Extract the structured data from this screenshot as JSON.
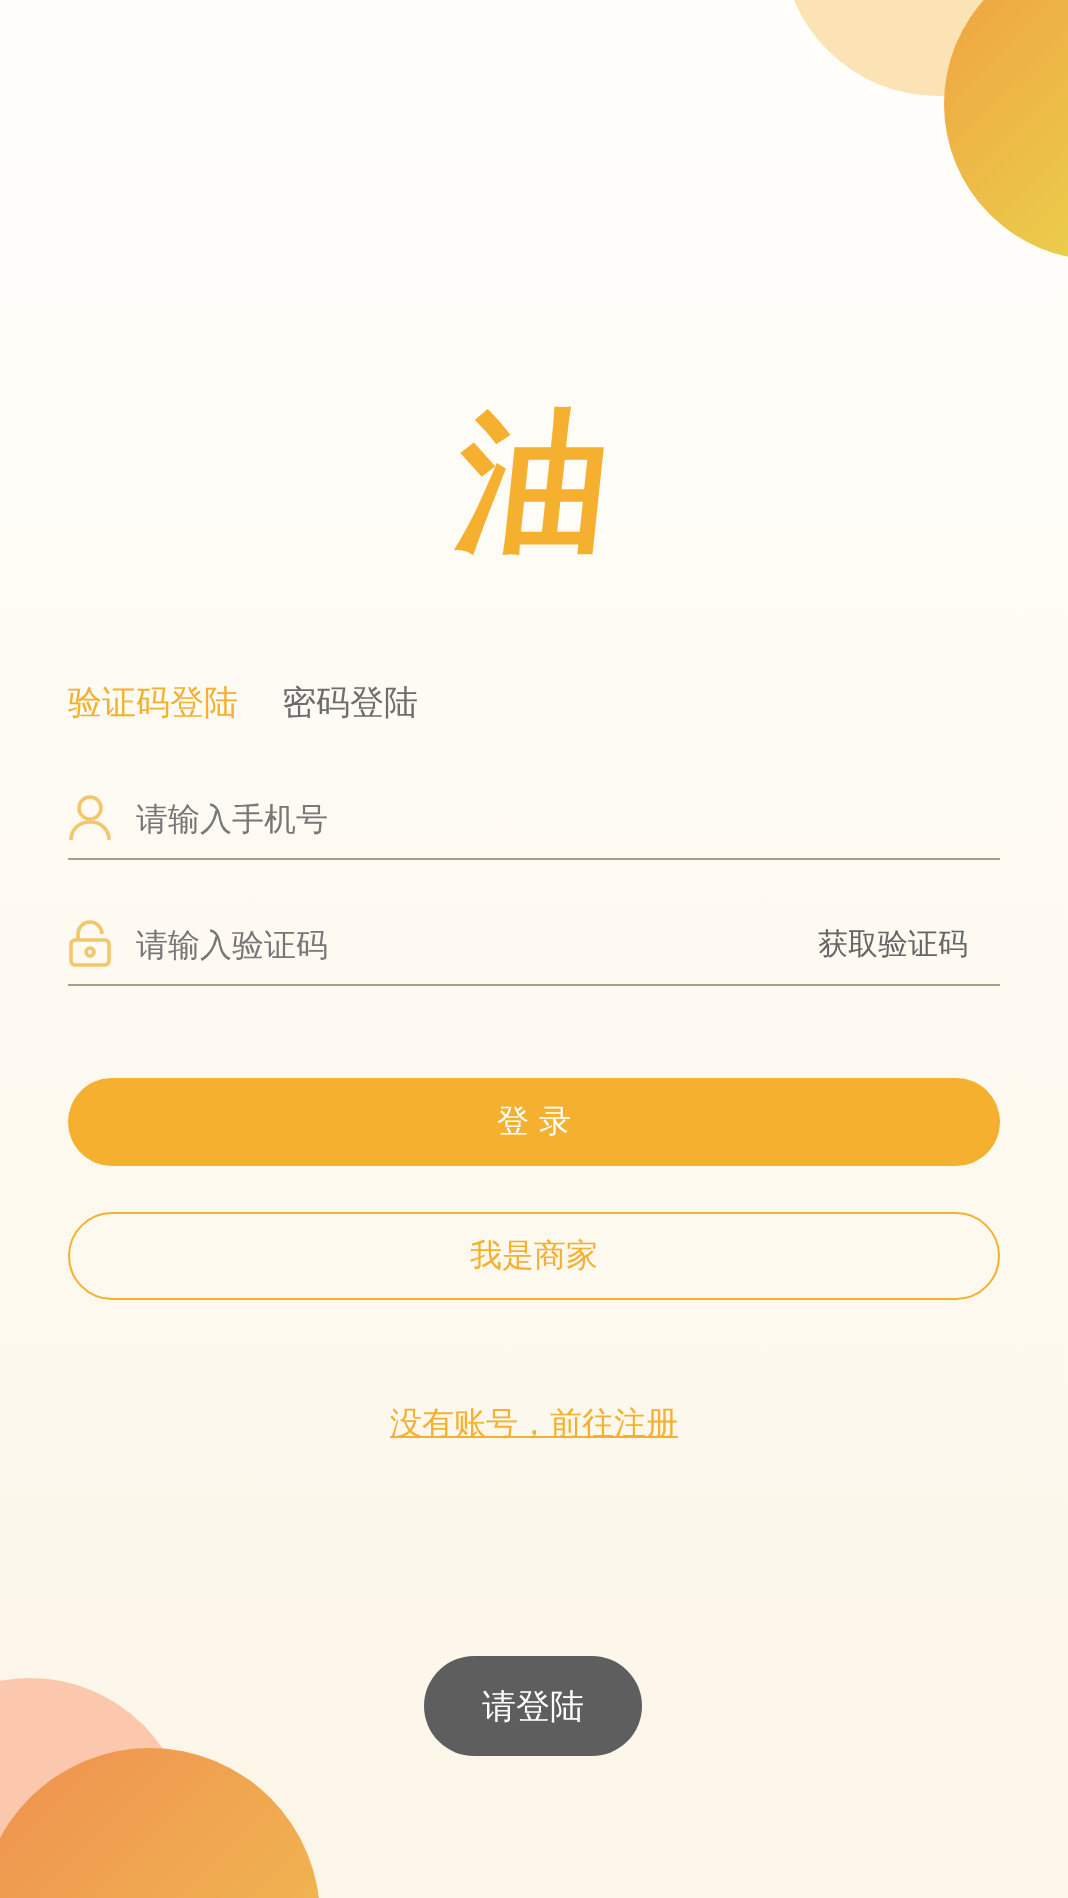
{
  "logo": {
    "text": "油"
  },
  "tabs": [
    {
      "label": "验证码登陆",
      "selected": true
    },
    {
      "label": "密码登陆",
      "selected": false
    }
  ],
  "fields": [
    {
      "kind": "phone",
      "placeholder": "请输入手机号"
    },
    {
      "kind": "code",
      "placeholder": "请输入验证码",
      "action": "获取验证码"
    }
  ],
  "buttons": [
    {
      "kind": "primary",
      "label": "登 录"
    },
    {
      "kind": "outline",
      "label": "我是商家"
    }
  ],
  "register_link": "没有账号，前往注册",
  "toast": "请登陆"
}
